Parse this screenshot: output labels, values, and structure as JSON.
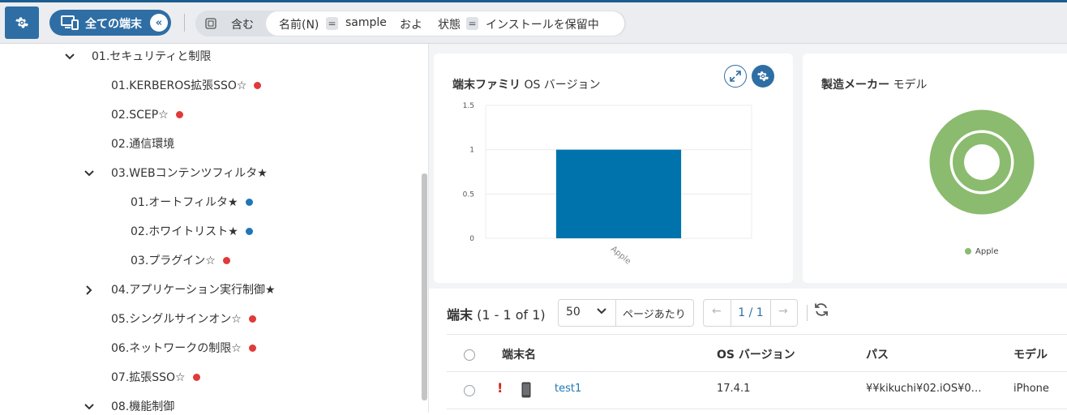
{
  "toolbar": {
    "gear_icon": "gear-icon",
    "devices_label": "全ての端末",
    "collapse_glyph": "«",
    "filter": {
      "operator": "含む",
      "cond1_field": "名前(N)",
      "cond1_eq": "=",
      "cond1_value": "sample",
      "conjunction": "およ",
      "cond2_field": "状態",
      "cond2_eq": "=",
      "cond2_value": "インストールを保留中"
    }
  },
  "tree": {
    "items": [
      {
        "label": "01.セキュリティと制限",
        "chevron": "down"
      },
      {
        "label": "01.KERBEROS拡張SSO☆",
        "dot": "#e03a3a"
      },
      {
        "label": "02.SCEP☆",
        "dot": "#e03a3a"
      },
      {
        "label": "02.通信環境"
      },
      {
        "label": "03.WEBコンテンツフィルタ★",
        "chevron": "down"
      },
      {
        "label": "01.オートフィルタ★",
        "dot": "#1f77b4"
      },
      {
        "label": "02.ホワイトリスト★",
        "dot": "#1f77b4"
      },
      {
        "label": "03.プラグイン☆",
        "dot": "#e03a3a"
      },
      {
        "label": "04.アプリケーション実行制御★",
        "chevron": "right"
      },
      {
        "label": "05.シングルサインオン☆",
        "dot": "#e03a3a"
      },
      {
        "label": "06.ネットワークの制限☆",
        "dot": "#e03a3a"
      },
      {
        "label": "07.拡張SSO☆",
        "dot": "#e03a3a"
      },
      {
        "label": "08.機能制御",
        "chevron": "down"
      }
    ]
  },
  "cards": {
    "os_version": {
      "title_bold": "端末ファミリ",
      "title_rest": " OS バージョン",
      "expand_icon": "expand-icon",
      "settings_icon": "gear-icon"
    },
    "manufacturer": {
      "title_bold": "製造メーカー",
      "title_rest": " モデル"
    }
  },
  "chart_data": [
    {
      "type": "bar",
      "categories": [
        "Apple"
      ],
      "values": [
        1
      ],
      "ylim": [
        0,
        1.5
      ],
      "yticks": [
        "0",
        "0.5",
        "1",
        "1.5"
      ],
      "grid": true,
      "color": "#0073ad"
    },
    {
      "type": "pie",
      "labels": [
        "Apple"
      ],
      "values": [
        1
      ],
      "legend": [
        "Apple"
      ],
      "legend_placement": "bottom",
      "color": "#8bbb6e"
    }
  ],
  "table": {
    "title_bold": "端末",
    "title_range": " (1 - 1 of 1)",
    "per_page_value": "50",
    "per_page_label": "ページあたり",
    "page_prev": "←",
    "page_indicator": "1 / 1",
    "page_next": "→",
    "refresh_icon": "refresh-icon",
    "columns": [
      "端末名",
      "OS バージョン",
      "パス",
      "モデル"
    ],
    "rows": [
      {
        "alert": "!",
        "device_icon": "smartphone-icon",
        "name": "test1",
        "os_version": "17.4.1",
        "path": "¥¥kikuchi¥02.iOS¥0…",
        "model": "iPhone"
      }
    ]
  }
}
